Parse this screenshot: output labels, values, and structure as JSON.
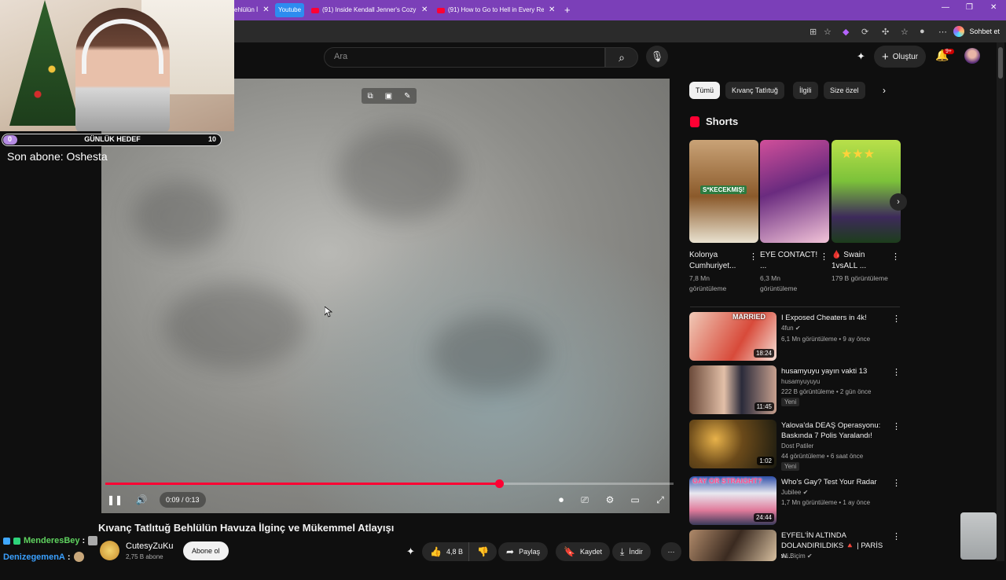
{
  "browser": {
    "tabs": [
      {
        "label": "ehlülün İ",
        "active": false
      },
      {
        "label": "Youtube",
        "active": true
      },
      {
        "label": "(91) Inside Kendall Jenner's Cozy M",
        "active": false
      },
      {
        "label": "(91) How to Go to Hell in Every Re",
        "active": false
      }
    ],
    "new_tab": "+",
    "window": {
      "minimize": "—",
      "restore": "❐",
      "close": "✕"
    },
    "chat_button": "Sohbet et"
  },
  "yt_header": {
    "search_placeholder": "Ara",
    "create_label": "Oluştur",
    "notif_badge": "9+"
  },
  "overlay": {
    "goal": {
      "min": "0",
      "label": "GÜNLÜK HEDEF",
      "max": "10",
      "progress": 0
    },
    "last_sub": "Son abone: Oshesta"
  },
  "player": {
    "time": "0:09 / 0:13",
    "progress_fraction": 0.6923
  },
  "video": {
    "title": "Kıvanç Tatlıtuğ Behlülün Havuza İlginç ve Mükemmel Atlayışı",
    "channel": "CutesyZuKu",
    "subs": "2,75 B abone",
    "subscribe_label": "Abone ol",
    "likes": "4,8 B",
    "share_label": "Paylaş",
    "save_label": "Kaydet",
    "download_label": "İndir"
  },
  "chat": [
    {
      "user": "MenderesBey",
      "sep": ":",
      "color": "#5fd35f"
    },
    {
      "user": "DenizegemenA",
      "sep": ":",
      "color": "#3aa0ff"
    }
  ],
  "sidebar": {
    "chips": [
      "Tümü",
      "Kıvanç Tatlıtuğ",
      "İlgili",
      "Size özel"
    ],
    "shorts_title": "Shorts",
    "shorts": [
      {
        "title": "Kolonya Cumhuriyet...",
        "views": "7,8 Mn görüntüleme",
        "thumb_text": "S*KECEKMIŞ!"
      },
      {
        "title": "EYE CONTACT! ...",
        "views": "6,3 Mn görüntüleme"
      },
      {
        "title": "🩸 Swain 1vsALL ...",
        "views": "179 B görüntüleme"
      }
    ],
    "recs": [
      {
        "title": "I Exposed Cheaters in 4k!",
        "channel": "4fun",
        "meta": "6,1 Mn görüntüleme • 9 ay önce",
        "duration": "18:24",
        "new": false,
        "thumb_text": "MARRIED",
        "verified": true
      },
      {
        "title": "husamyuyu yayın vakti 13",
        "channel": "husamyuyuyu",
        "meta": "222 B görüntüleme • 2 gün önce",
        "duration": "11:45",
        "new": true,
        "new_label": "Yeni"
      },
      {
        "title": "Yalova'da DEAŞ Operasyonu: Baskında 7 Polis Yaralandı!",
        "channel": "Dost Patiler",
        "meta": "44 görüntüleme • 6 saat önce",
        "duration": "1:02",
        "new": true,
        "new_label": "Yeni"
      },
      {
        "title": "Who's Gay? Test Your Radar",
        "channel": "Jubilee",
        "meta": "1,7 Mn görüntüleme • 1 ay önce",
        "duration": "24:44",
        "new": false,
        "thumb_text": "GAY OR STRAIGHT?",
        "verified": true
      },
      {
        "title": "EYFEL'İN ALTINDA DOLANDIRILDIKS 🔺 | PARİS w...",
        "channel": "Ali Biçim",
        "meta": "",
        "duration": "",
        "new": false,
        "verified": true
      }
    ]
  },
  "colors": {
    "accent": "#ff0033",
    "tabbar": "#7b3fb8",
    "bg": "#0f0f0f"
  }
}
